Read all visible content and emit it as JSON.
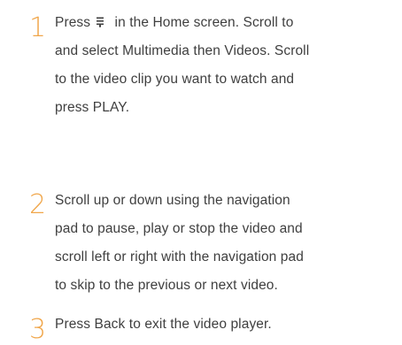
{
  "steps": [
    {
      "number": "1",
      "text_before_icon": "Press",
      "icon": "menu-icon",
      "lines": [
        " in the Home screen. Scroll to",
        "and select Multimedia then Videos. Scroll",
        "to the video clip you want to watch and",
        "press PLAY."
      ]
    },
    {
      "number": "2",
      "lines": [
        "Scroll up or down using the navigation",
        "pad to pause, play or stop the video and",
        "scroll left or right with the navigation pad",
        "to skip to the previous or next video."
      ]
    },
    {
      "number": "3",
      "lines": [
        "Press Back to exit the video player."
      ]
    }
  ],
  "colors": {
    "number": "#f0a64a",
    "text": "#3f3f3f"
  }
}
